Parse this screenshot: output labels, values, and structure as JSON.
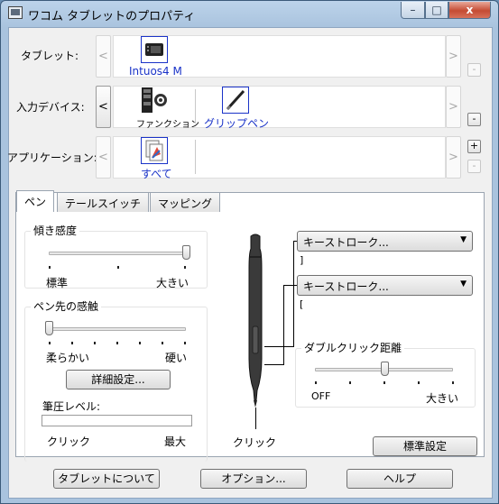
{
  "window": {
    "title": "ワコム タブレットのプロパティ",
    "min": "–",
    "max": "□",
    "close": "x"
  },
  "rows": {
    "tablet": {
      "label": "タブレット:",
      "items": [
        {
          "label": "Intuos4 M",
          "icon": "tablet-icon"
        }
      ]
    },
    "device": {
      "label": "入力デバイス:",
      "items": [
        {
          "label": "ファンクション",
          "icon": "function-keys-icon"
        },
        {
          "label": "グリップペン",
          "icon": "grip-pen-icon"
        }
      ]
    },
    "app": {
      "label": "アプリケーション:",
      "items": [
        {
          "label": "すべて",
          "icon": "all-applications-icon"
        }
      ]
    },
    "arrow_left": "<",
    "arrow_right": ">",
    "plus": "+",
    "minus": "-"
  },
  "tabs": [
    "ペン",
    "テールスイッチ",
    "マッピング"
  ],
  "tilt": {
    "title": "傾き感度",
    "min_label": "標準",
    "max_label": "大きい",
    "level": 1.0
  },
  "tip_feel": {
    "title": "ペン先の感触",
    "min_label": "柔らかい",
    "max_label": "硬い",
    "level": 0.0,
    "details_button": "詳細設定...",
    "pressure_label": "筆圧レベル:",
    "click_label": "クリック",
    "max_label2": "最大"
  },
  "pen": {
    "click_label": "クリック"
  },
  "buttons": {
    "upper": "キーストローク...",
    "upper_value": "]",
    "lower": "キーストローク...",
    "lower_value": "["
  },
  "double_click": {
    "title": "ダブルクリック距離",
    "min_label": "OFF",
    "max_label": "大きい",
    "level": 0.5
  },
  "defaults_button": "標準設定",
  "footer": {
    "about": "タブレットについて",
    "options": "オプション...",
    "help": "ヘルプ"
  }
}
